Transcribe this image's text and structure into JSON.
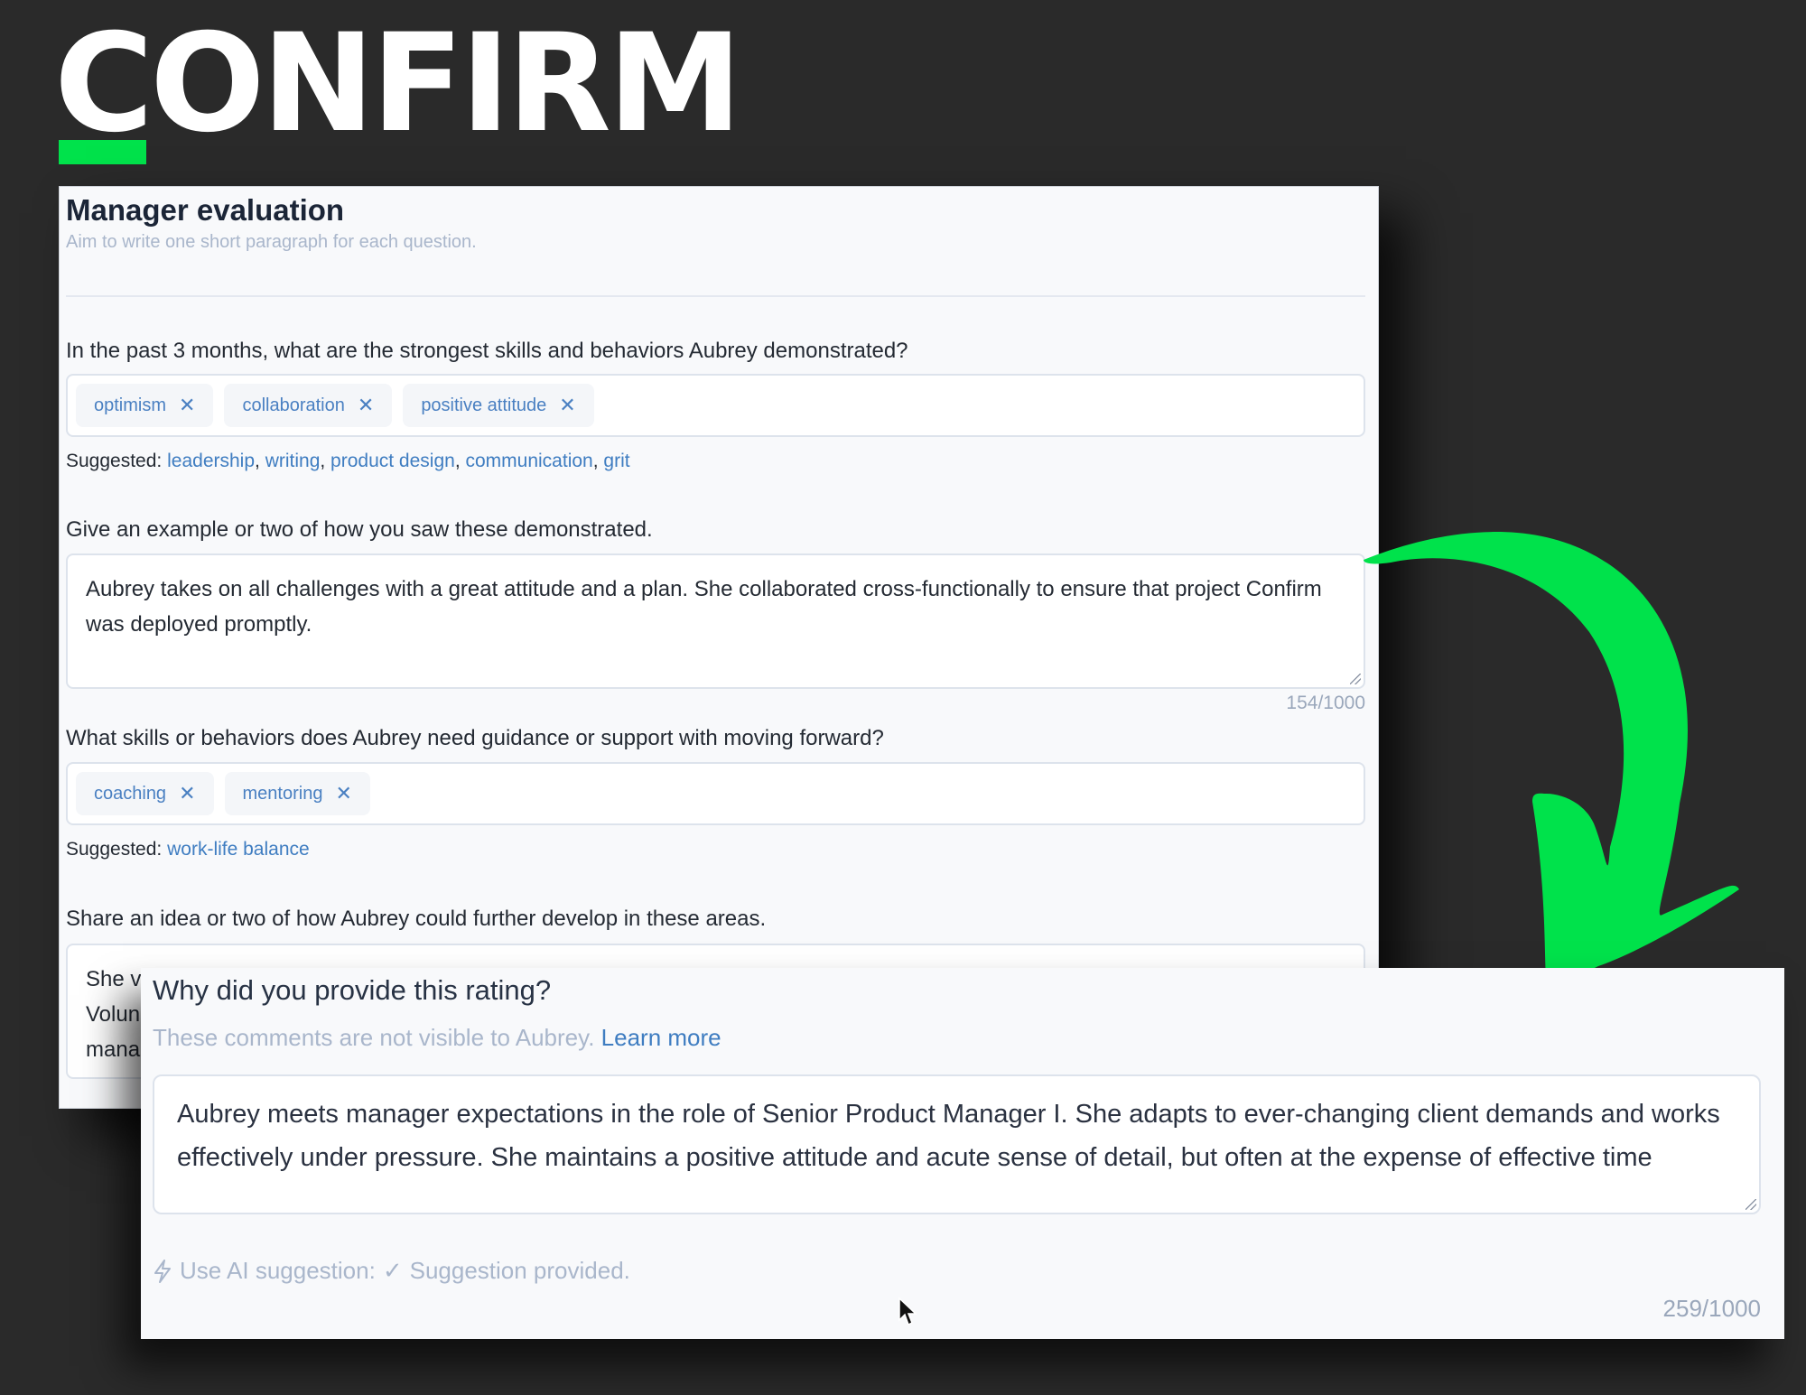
{
  "brand": {
    "logo_text": "CONFIRM",
    "accent_color": "#00e24b"
  },
  "evaluation_form": {
    "title": "Manager evaluation",
    "subtitle": "Aim to write one short paragraph for each question.",
    "questions": [
      {
        "label": "In the past 3 months, what are the strongest skills and behaviors Aubrey demonstrated?",
        "type": "tags",
        "tags": [
          "optimism",
          "collaboration",
          "positive attitude"
        ],
        "suggested_label": "Suggested:",
        "suggested": [
          "leadership",
          "writing",
          "product design",
          "communication",
          "grit"
        ]
      },
      {
        "label": "Give an example or two of how you saw these demonstrated.",
        "type": "textarea",
        "value": "Aubrey takes on all challenges with a great attitude and a plan. She collaborated cross-functionally to ensure that project Confirm was deployed promptly.",
        "counter": "154/1000"
      },
      {
        "label": "What skills or behaviors does Aubrey need guidance or support with moving forward?",
        "type": "tags",
        "tags": [
          "coaching",
          "mentoring"
        ],
        "suggested_label": "Suggested:",
        "suggested": [
          "work-life balance"
        ]
      },
      {
        "label": "Share an idea or two of how Aubrey could further develop in these areas.",
        "type": "textarea",
        "value_visible_fragments": [
          "She v",
          "Volun",
          "mana"
        ]
      }
    ]
  },
  "rating_comment": {
    "title": "Why did you provide this rating?",
    "subtitle": "These comments are not visible to Aubrey.",
    "learn_more": "Learn more",
    "value": "Aubrey meets manager expectations in the role of Senior Product Manager I. She adapts to ever-changing client demands and works effectively under pressure. She maintains a positive attitude and acute sense of detail, but often at the expense of effective time",
    "ai_label": "Use AI suggestion:",
    "ai_status": "Suggestion provided.",
    "ai_icon": "lightning-icon",
    "check_icon": "check-icon",
    "counter": "259/1000"
  }
}
